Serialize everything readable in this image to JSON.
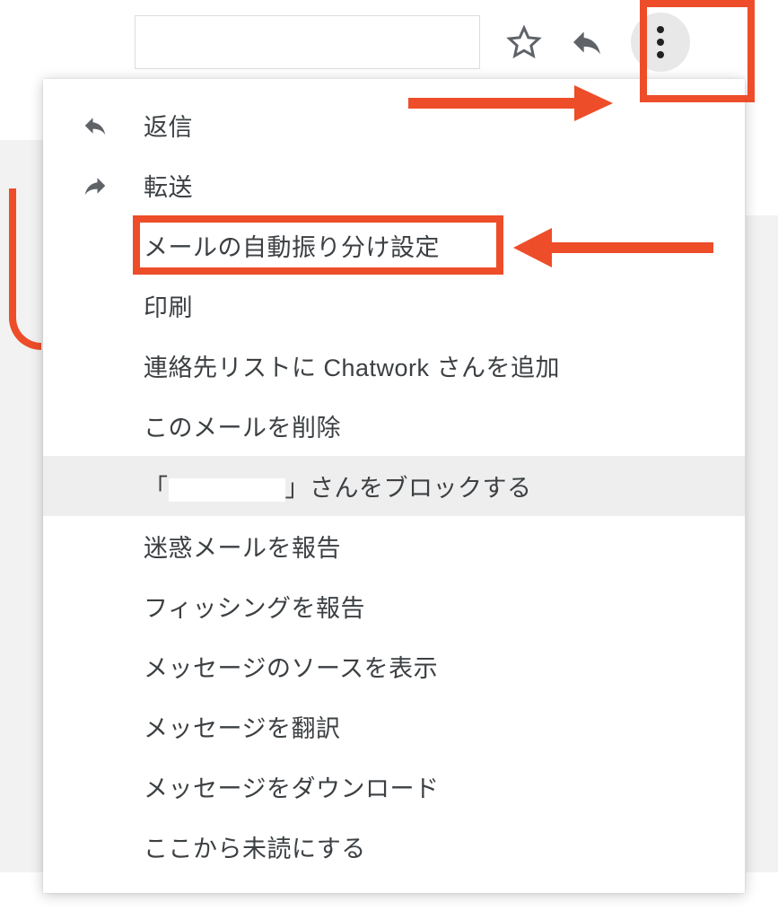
{
  "toolbar": {
    "search_placeholder": ""
  },
  "menu": {
    "reply": "返信",
    "forward": "転送",
    "filter": "メールの自動振り分け設定",
    "print": "印刷",
    "add_contact": "連絡先リストに Chatwork さんを追加",
    "delete": "このメールを削除",
    "block_prefix": "「",
    "block_suffix": "」さんをブロックする",
    "report_spam": "迷惑メールを報告",
    "report_phishing": "フィッシングを報告",
    "show_original": "メッセージのソースを表示",
    "translate": "メッセージを翻訳",
    "download": "メッセージをダウンロード",
    "mark_unread": "ここから未読にする"
  },
  "annotations": {
    "highlight_color": "#ee4d2a"
  }
}
